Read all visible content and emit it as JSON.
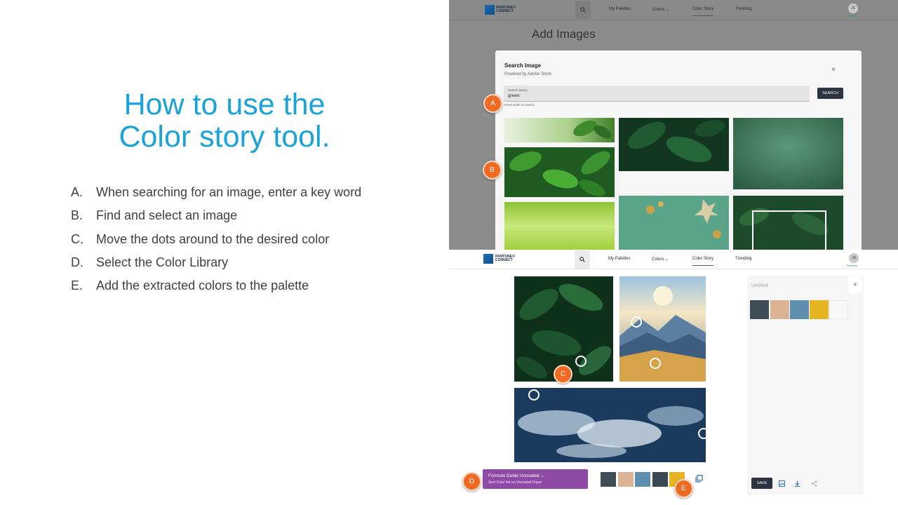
{
  "slide": {
    "title_line1": "How to use the",
    "title_line2": "Color story tool.",
    "steps": [
      {
        "letter": "A.",
        "text": "When searching for an image, enter a key word"
      },
      {
        "letter": "B.",
        "text": "Find and select an image"
      },
      {
        "letter": "C.",
        "text": "Move the dots around to the desired color"
      },
      {
        "letter": "D.",
        "text": "Select the Color Library"
      },
      {
        "letter": "E.",
        "text": "Add the extracted colors to the palette"
      }
    ]
  },
  "nav": {
    "logo_line1": "PANTONE®",
    "logo_line2": "CONNECT",
    "search_icon": "magnifier",
    "my_palettes": "My Palettes",
    "colors": "Colors",
    "colors_icon": "chevron-down",
    "color_story": "Color Story",
    "trending": "Trending",
    "avatar_initials": "JS",
    "avatar_badge": "Premium"
  },
  "top_screenshot": {
    "page_heading": "Add Images",
    "modal_title": "Search Image",
    "modal_subtitle": "Powered by Adobe Stock",
    "close_icon": "×",
    "query_label": "Search Query",
    "query_value": "green",
    "search_button": "SEARCH",
    "helper_text": "Press enter to search",
    "results": [
      {
        "description": "green leaves on bright background",
        "color": "#a9cf8a"
      },
      {
        "description": "dark green leaves",
        "color": "#1c4a2a"
      },
      {
        "description": "green textured background",
        "color": "#3f7a5d"
      },
      {
        "description": "bright green leaves",
        "color": "#2f7d2f"
      },
      {
        "description": "lime green gradient",
        "color": "#9fcf3a"
      },
      {
        "description": "mint background with gold decorations",
        "color": "#5aa58a"
      },
      {
        "description": "green leaves with white frame",
        "color": "#1f4a2a"
      }
    ]
  },
  "bottom_screenshot": {
    "images": [
      {
        "description": "dark green leaves",
        "color": "#1d4a2b"
      },
      {
        "description": "mountain sunset",
        "color": "#c9a25b"
      },
      {
        "description": "ocean waves",
        "color": "#1f3f63"
      }
    ],
    "color_library": {
      "name": "Formula Guide Uncoated",
      "name_icon": "chevron-down",
      "subtitle": "Spot Color Ink on Uncoated Paper"
    },
    "extracted_swatches": [
      "#3e4c55",
      "#dcb394",
      "#5e8fae",
      "#3a4a54",
      "#e6b521"
    ],
    "add_to_palette_icon": "copy-to-palette",
    "palette": {
      "title": "Untitled",
      "add_icon": "+",
      "swatches": [
        "#3e4c55",
        "#dcb394",
        "#5e8fae",
        "#e6b521",
        "#f8f8f8"
      ],
      "save_button": "SAVE",
      "tool_icons": [
        "image-icon",
        "download-icon",
        "share-icon"
      ]
    }
  },
  "markers": [
    "A",
    "B",
    "C",
    "D",
    "E"
  ],
  "colors": {
    "title_blue": "#1aa3d9",
    "marker_orange": "#ef6a23",
    "library_purple": "#8f4aa6",
    "button_dark": "#2b3440"
  }
}
